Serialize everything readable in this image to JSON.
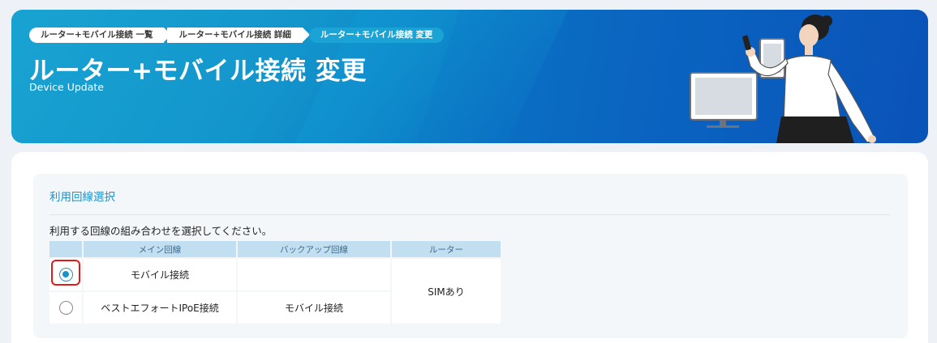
{
  "header": {
    "breadcrumb": [
      {
        "label": "ルーター+モバイル接続 一覧"
      },
      {
        "label": "ルーター+モバイル接続 詳細"
      },
      {
        "label": "ルーター+モバイル接続 変更"
      }
    ],
    "title": "ルーター+モバイル接続 変更",
    "subtitle": "Device Update"
  },
  "section": {
    "title": "利用回線選択",
    "description": "利用する回線の組み合わせを選択してください。",
    "table": {
      "headers": {
        "main_line": "メイン回線",
        "backup_line": "バックアップ回線",
        "router": "ルーター"
      },
      "rows": [
        {
          "selected": true,
          "main_line": "モバイル接続",
          "backup_line": ""
        },
        {
          "selected": false,
          "main_line": "ベストエフォートIPoE接続",
          "backup_line": "モバイル接続"
        }
      ],
      "router_value": "SIMあり"
    }
  },
  "colors": {
    "accent": "#1b92c9",
    "banner": "#0a6fc2",
    "highlight": "#e01b1b"
  }
}
